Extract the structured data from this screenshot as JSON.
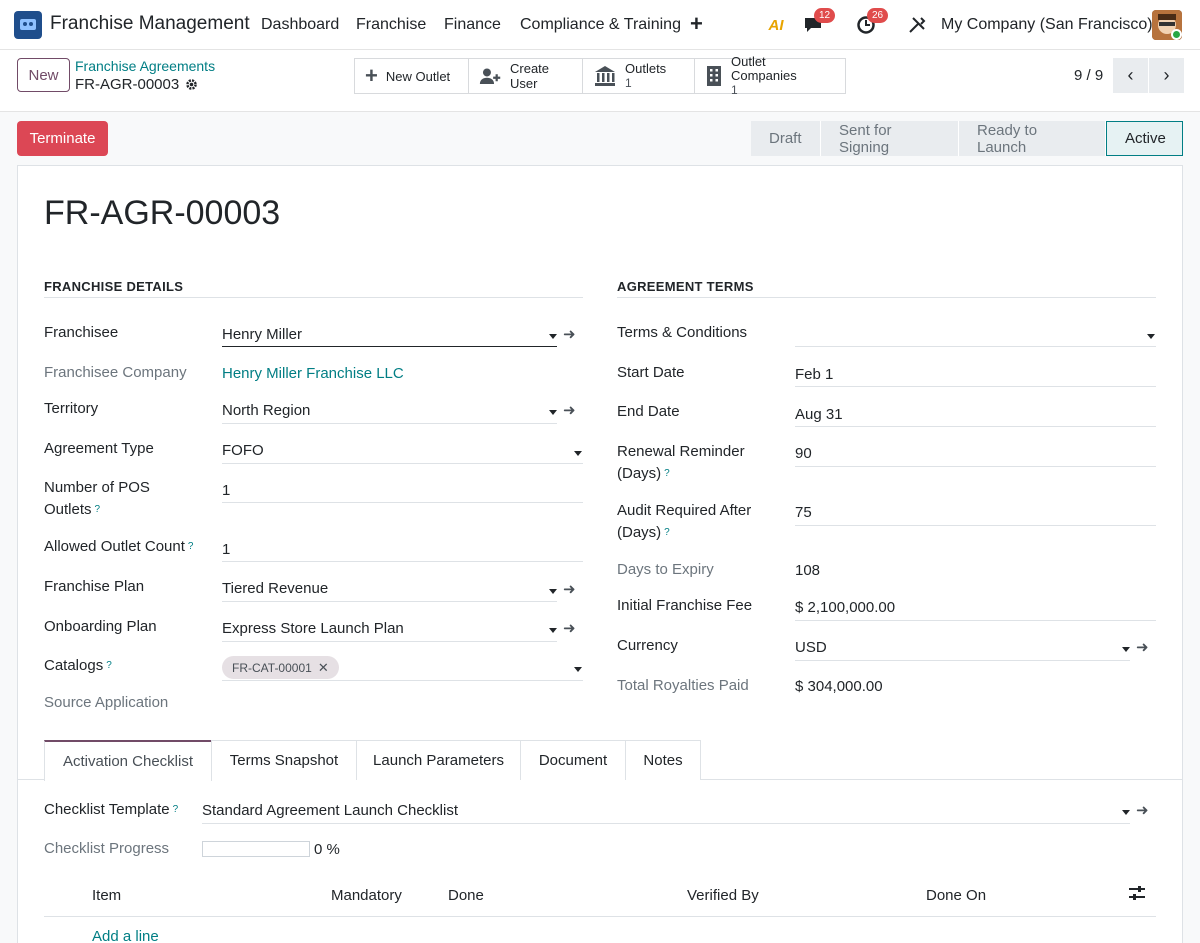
{
  "navbar": {
    "app_name": "Franchise Management",
    "menus": [
      "Dashboard",
      "Franchise",
      "Finance",
      "Compliance & Training"
    ],
    "plus": "+",
    "ai_label": "AI",
    "messages_count": "12",
    "activities_count": "26",
    "company": "My Company (San Francisco)"
  },
  "control": {
    "new_label": "New",
    "breadcrumb": "Franchise Agreements",
    "record": "FR-AGR-00003",
    "smart_buttons": {
      "new_outlet": "New Outlet",
      "create_user": "Create User",
      "outlets_label": "Outlets",
      "outlets_count": "1",
      "outlet_companies_label": "Outlet Companies",
      "outlet_companies_count": "1"
    },
    "pager": "9 / 9"
  },
  "statusbar": {
    "terminate_label": "Terminate",
    "stages": [
      "Draft",
      "Sent for Signing",
      "Ready to Launch",
      "Active"
    ],
    "active_stage": "Active"
  },
  "form": {
    "title": "FR-AGR-00003",
    "franchise_details": {
      "heading": "FRANCHISE DETAILS",
      "franchisee_label": "Franchisee",
      "franchisee": "Henry Miller",
      "franchisee_company_label": "Franchisee Company",
      "franchisee_company": "Henry Miller Franchise LLC",
      "territory_label": "Territory",
      "territory": "North Region",
      "agreement_type_label": "Agreement Type",
      "agreement_type": "FOFO",
      "pos_outlets_label_1": "Number of POS",
      "pos_outlets_label_2": "Outlets",
      "pos_outlets": "1",
      "allowed_outlets_label": "Allowed Outlet Count",
      "allowed_outlets": "1",
      "franchise_plan_label": "Franchise Plan",
      "franchise_plan": "Tiered Revenue",
      "onboarding_plan_label": "Onboarding Plan",
      "onboarding_plan": "Express Store Launch Plan",
      "catalogs_label": "Catalogs",
      "catalog_tag": "FR-CAT-00001",
      "source_application_label": "Source Application"
    },
    "agreement_terms": {
      "heading": "AGREEMENT TERMS",
      "terms_label": "Terms & Conditions",
      "start_date_label": "Start Date",
      "start_date": "Feb 1",
      "end_date_label": "End Date",
      "end_date": "Aug 31",
      "renewal_label_1": "Renewal Reminder",
      "renewal_label_2": "(Days)",
      "renewal": "90",
      "audit_label_1": "Audit Required After",
      "audit_label_2": "(Days)",
      "audit": "75",
      "days_to_expiry_label": "Days to Expiry",
      "days_to_expiry": "108",
      "initial_fee_label": "Initial Franchise Fee",
      "initial_fee": "$ 2,100,000.00",
      "currency_label": "Currency",
      "currency": "USD",
      "royalties_label": "Total Royalties Paid",
      "royalties": "$ 304,000.00"
    },
    "tabs": [
      "Activation Checklist",
      "Terms Snapshot",
      "Launch Parameters",
      "Document",
      "Notes"
    ],
    "checklist": {
      "template_label": "Checklist Template",
      "template": "Standard Agreement Launch Checklist",
      "progress_label": "Checklist Progress",
      "progress_value": "0",
      "progress_unit": "%",
      "columns": [
        "Item",
        "Mandatory",
        "Done",
        "Verified By",
        "Done On"
      ],
      "add_line": "Add a line"
    }
  }
}
